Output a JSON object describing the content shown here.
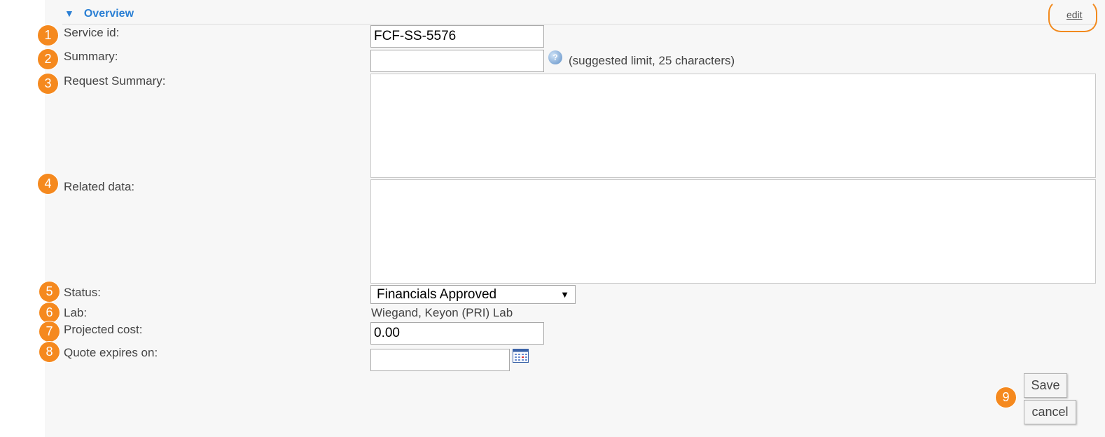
{
  "section": {
    "title": "Overview",
    "edit_label": "edit"
  },
  "badges": [
    "1",
    "2",
    "3",
    "4",
    "5",
    "6",
    "7",
    "8",
    "9"
  ],
  "form": {
    "service_id": {
      "label": "Service id:",
      "value": "FCF-SS-5576"
    },
    "summary": {
      "label": "Summary:",
      "value": "",
      "hint": "(suggested limit, 25 characters)"
    },
    "request_summary": {
      "label": "Request Summary:",
      "value": ""
    },
    "related_data": {
      "label": "Related data:",
      "value": ""
    },
    "status": {
      "label": "Status:",
      "value": "Financials Approved"
    },
    "lab": {
      "label": "Lab:",
      "value": "Wiegand, Keyon (PRI) Lab"
    },
    "projected_cost": {
      "label": "Projected cost:",
      "value": "0.00"
    },
    "quote_expires": {
      "label": "Quote expires on:",
      "value": ""
    }
  },
  "buttons": {
    "save": "Save",
    "cancel": "cancel"
  },
  "colors": {
    "accent": "#2a7fd4",
    "badge": "#f5891e",
    "panel_bg": "#f7f7f7"
  },
  "icons": {
    "toggle": "triangle-down-icon",
    "help": "help-icon",
    "calendar": "calendar-icon"
  }
}
